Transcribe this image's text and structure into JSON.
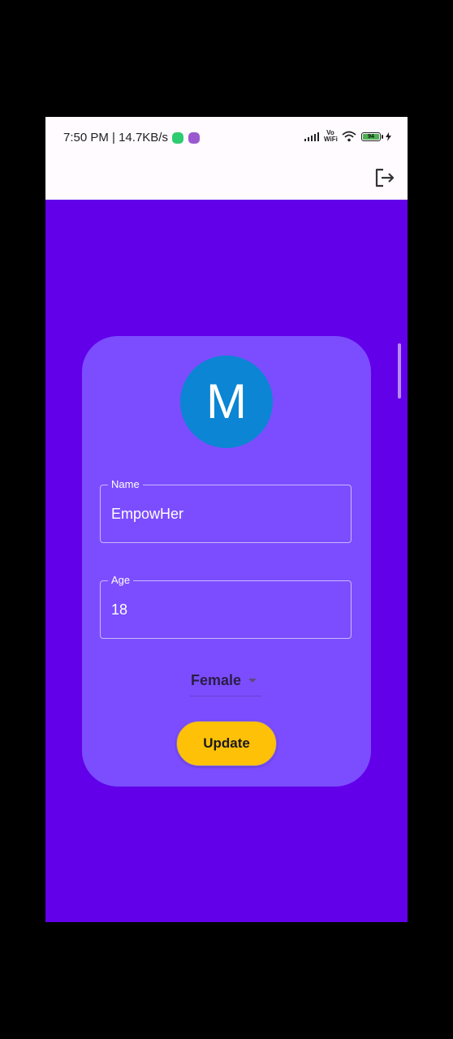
{
  "status_bar": {
    "time_speed": "7:50 PM | 14.7KB/s",
    "network_label": "Vo WiFi",
    "battery_level": "94"
  },
  "app_bar": {
    "action_icon": "logout-icon"
  },
  "profile": {
    "avatar_initial": "M",
    "name_label": "Name",
    "name_value": "EmpowHer",
    "age_label": "Age",
    "age_value": "18",
    "gender_value": "Female",
    "update_label": "Update"
  },
  "colors": {
    "background": "#6200ea",
    "card": "#7c4dff",
    "avatar": "#0b85d4",
    "button": "#ffc107"
  }
}
